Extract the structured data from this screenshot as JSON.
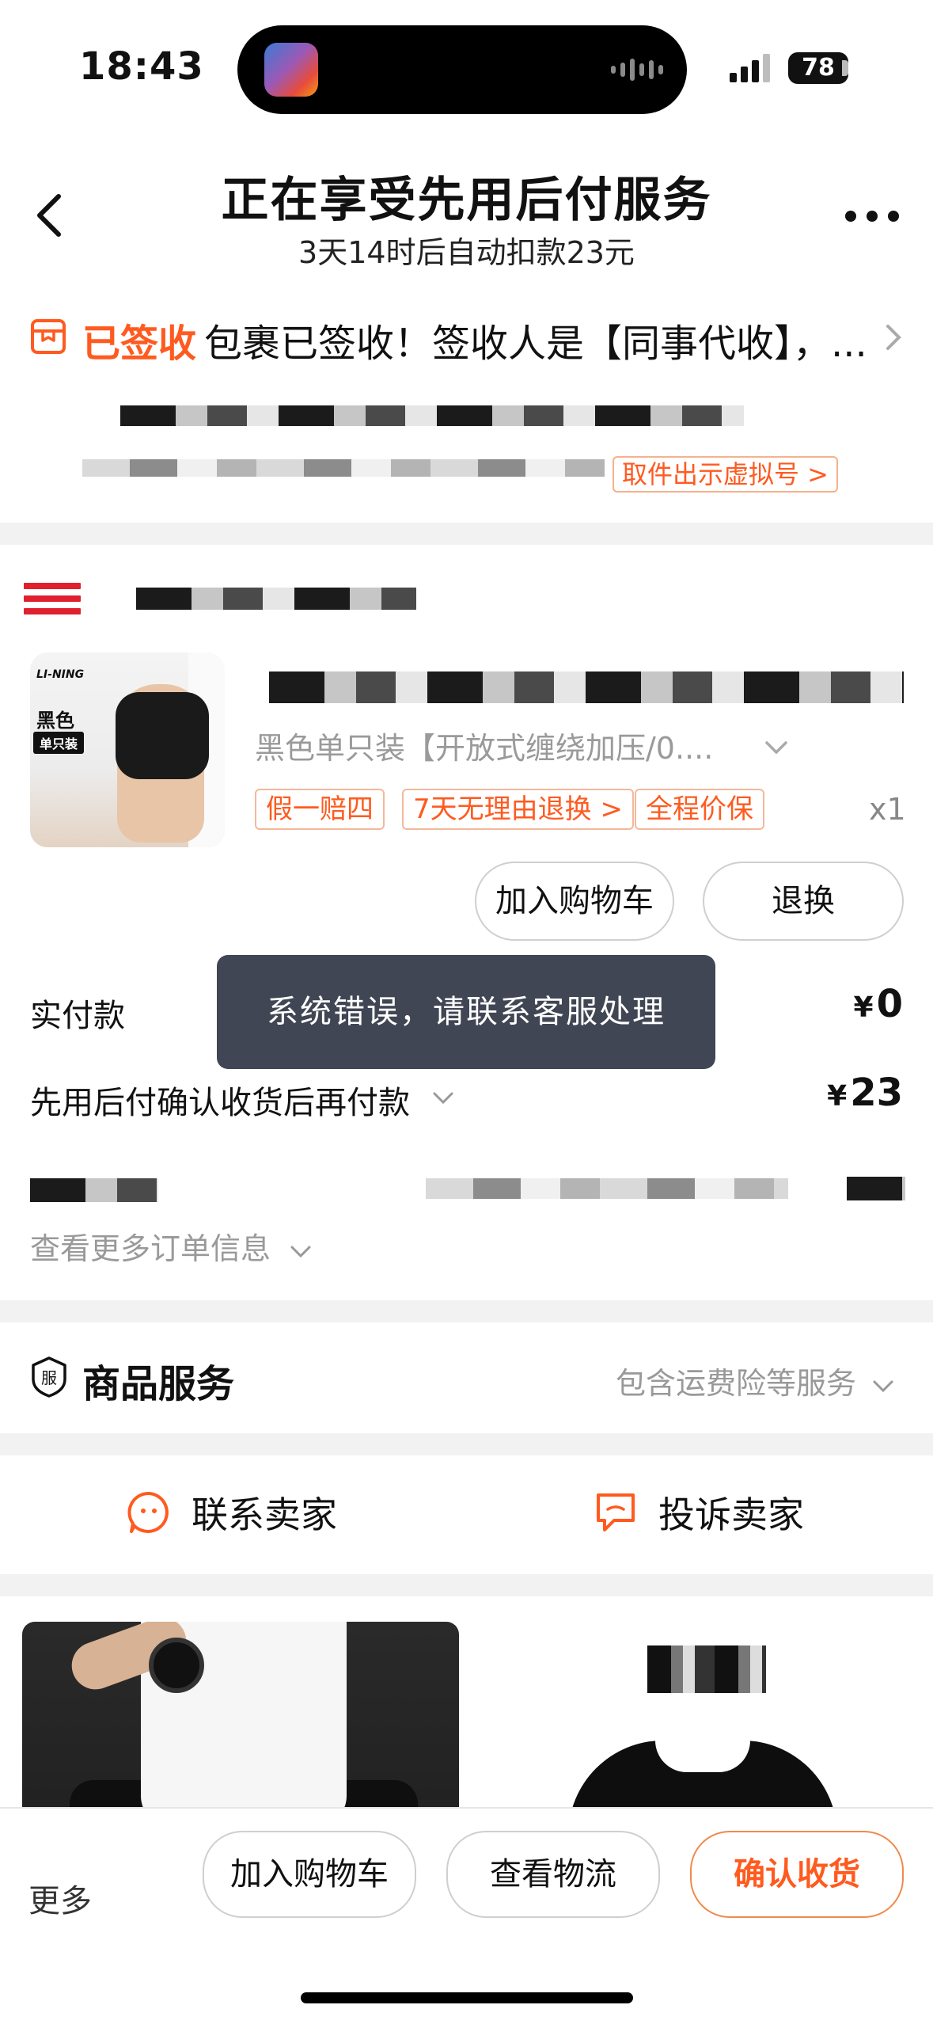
{
  "status_bar": {
    "time": "18:43",
    "battery": "78"
  },
  "header": {
    "title": "正在享受先用后付服务",
    "subtitle": "3天14时后自动扣款23元"
  },
  "logistics": {
    "status": "已签收",
    "text": "包裹已签收！签收人是【同事代收】，...",
    "pickup_link": "取件出示虚拟号 >"
  },
  "product": {
    "thumb_brand": "LI-NING",
    "thumb_color": "黑色",
    "thumb_pack": "单只装",
    "sku": "黑色单只装【开放式缠绕加压/0....",
    "tags": [
      "假一赔四",
      "7天无理由退换 >",
      "全程价保"
    ],
    "quantity": "x1",
    "buttons": {
      "add_to_cart": "加入购物车",
      "return": "退换"
    }
  },
  "payment": {
    "paid_label": "实付款",
    "paid_currency": "¥",
    "paid_value": "0",
    "later_label": "先用后付确认收货后再付款",
    "later_currency": "¥",
    "later_value": "23"
  },
  "toast": "系统错误，请联系客服处理",
  "more_order_info": "查看更多订单信息",
  "service": {
    "title": "商品服务",
    "desc": "包含运费险等服务"
  },
  "contact": {
    "contact_seller": "联系卖家",
    "complain_seller": "投诉卖家"
  },
  "bottom_bar": {
    "more": "更多",
    "add_to_cart": "加入购物车",
    "view_logistics": "查看物流",
    "confirm_receipt": "确认收货"
  },
  "colors": {
    "accent": "#ff5a1f",
    "toast_bg": "#404653",
    "shop_logo": "#e0202f"
  }
}
